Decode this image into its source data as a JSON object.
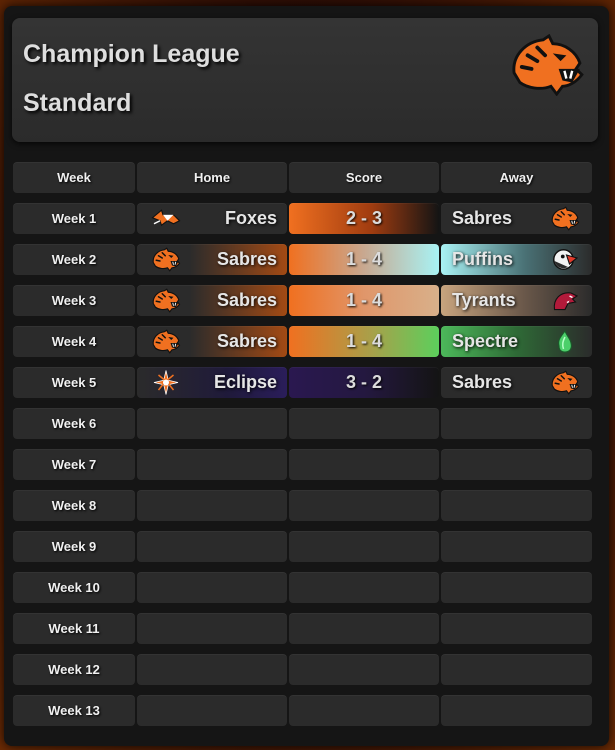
{
  "header": {
    "title_line1": "Champion League",
    "title_line2": "Standard",
    "logo_icon": "sabres-tiger-icon"
  },
  "columns": {
    "week": "Week",
    "home": "Home",
    "score": "Score",
    "away": "Away"
  },
  "colors": {
    "sabres": "#f07020",
    "foxes": "#f07020",
    "puffins": "#a8f2f4",
    "tyrants": "#d8b08a",
    "spectre": "#5ccf5c",
    "eclipse": "#2a1850"
  },
  "rows": [
    {
      "week": "Week 1",
      "home": "Foxes",
      "home_icon": "fox-icon",
      "score": "2 - 3",
      "away": "Sabres",
      "away_icon": "tiger-icon"
    },
    {
      "week": "Week 2",
      "home": "Sabres",
      "home_icon": "tiger-icon",
      "score": "1 - 4",
      "away": "Puffins",
      "away_icon": "puffin-icon"
    },
    {
      "week": "Week 3",
      "home": "Sabres",
      "home_icon": "tiger-icon",
      "score": "1 - 4",
      "away": "Tyrants",
      "away_icon": "dinosaur-icon"
    },
    {
      "week": "Week 4",
      "home": "Sabres",
      "home_icon": "tiger-icon",
      "score": "1 - 4",
      "away": "Spectre",
      "away_icon": "ghost-flame-icon"
    },
    {
      "week": "Week 5",
      "home": "Eclipse",
      "home_icon": "compass-star-icon",
      "score": "3 - 2",
      "away": "Sabres",
      "away_icon": "tiger-icon"
    },
    {
      "week": "Week 6"
    },
    {
      "week": "Week 7"
    },
    {
      "week": "Week 8"
    },
    {
      "week": "Week 9"
    },
    {
      "week": "Week 10"
    },
    {
      "week": "Week 11"
    },
    {
      "week": "Week 12"
    },
    {
      "week": "Week 13"
    }
  ]
}
